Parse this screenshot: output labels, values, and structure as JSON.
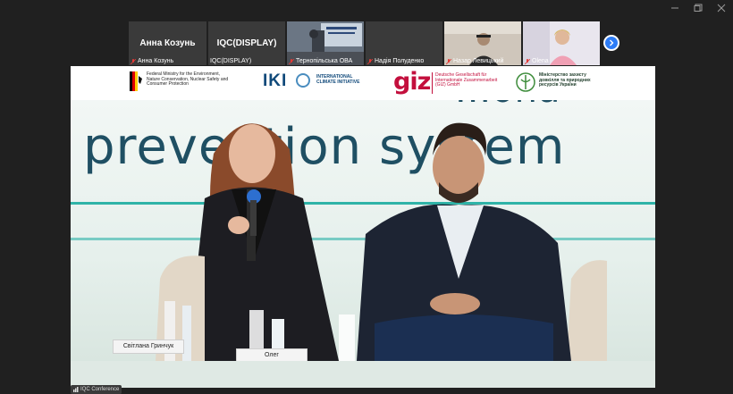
{
  "participants": [
    {
      "display": "Анна Козунь",
      "label": "Анна Козунь",
      "muted": true,
      "video": false
    },
    {
      "display": "IQC(DISPLAY)",
      "label": "IQC(DISPLAY)",
      "muted": false,
      "video": false
    },
    {
      "label": "Тернопільська ОВА",
      "muted": true,
      "video": true
    },
    {
      "label": "Надія Полуденко",
      "muted": true,
      "video": false
    },
    {
      "label": "Назар Левицький",
      "muted": true,
      "video": true
    },
    {
      "label": "Olena",
      "muted": true,
      "video": true
    }
  ],
  "sponsors": {
    "bmu": "Federal Ministry for the Environment, Nature Conservation, Nuclear Safety and Consumer Protection",
    "iki_mark": "IKI",
    "iki_text": "INTERNATIONAL CLIMATE INITIATIVE",
    "giz_mark": "giz",
    "giz_text": "Deutsche Gesellschaft für Internationale Zusammenarbeit (GIZ) GmbH",
    "ministry": "Міністерство захисту довкілля та природних ресурсів України"
  },
  "banner": {
    "top_word": "prevention system",
    "top_fragment": "...ona"
  },
  "name_cards": [
    "Світлана Гринчук",
    "Олег"
  ],
  "main_label": "IQC Conference",
  "colors": {
    "accent": "#2d7cf6",
    "mute": "#e53935",
    "background": "#202020"
  }
}
